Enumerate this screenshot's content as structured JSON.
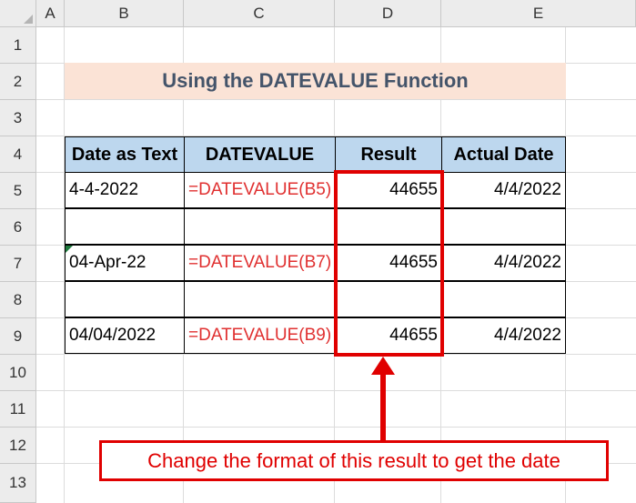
{
  "columns": [
    "A",
    "B",
    "C",
    "D",
    "E"
  ],
  "rows": [
    "1",
    "2",
    "3",
    "4",
    "5",
    "6",
    "7",
    "8",
    "9",
    "10",
    "11",
    "12",
    "13"
  ],
  "title": "Using the DATEVALUE Function",
  "table": {
    "headers": [
      "Date as Text",
      "DATEVALUE",
      "Result",
      "Actual Date"
    ],
    "rows": [
      {
        "date_text": "4-4-2022",
        "formula": "=DATEVALUE(B5)",
        "result": "44655",
        "actual": "4/4/2022"
      },
      {
        "date_text": "",
        "formula": "",
        "result": "",
        "actual": ""
      },
      {
        "date_text": "04-Apr-22",
        "formula": "=DATEVALUE(B7)",
        "result": "44655",
        "actual": "4/4/2022"
      },
      {
        "date_text": "",
        "formula": "",
        "result": "",
        "actual": ""
      },
      {
        "date_text": "04/04/2022",
        "formula": "=DATEVALUE(B9)",
        "result": "44655",
        "actual": "4/4/2022"
      }
    ]
  },
  "callout": "Change the format of this result to get the date",
  "colors": {
    "title_bg": "#fbe3d6",
    "header_bg": "#bdd7ee",
    "accent": "#e00000",
    "formula": "#e03030"
  }
}
